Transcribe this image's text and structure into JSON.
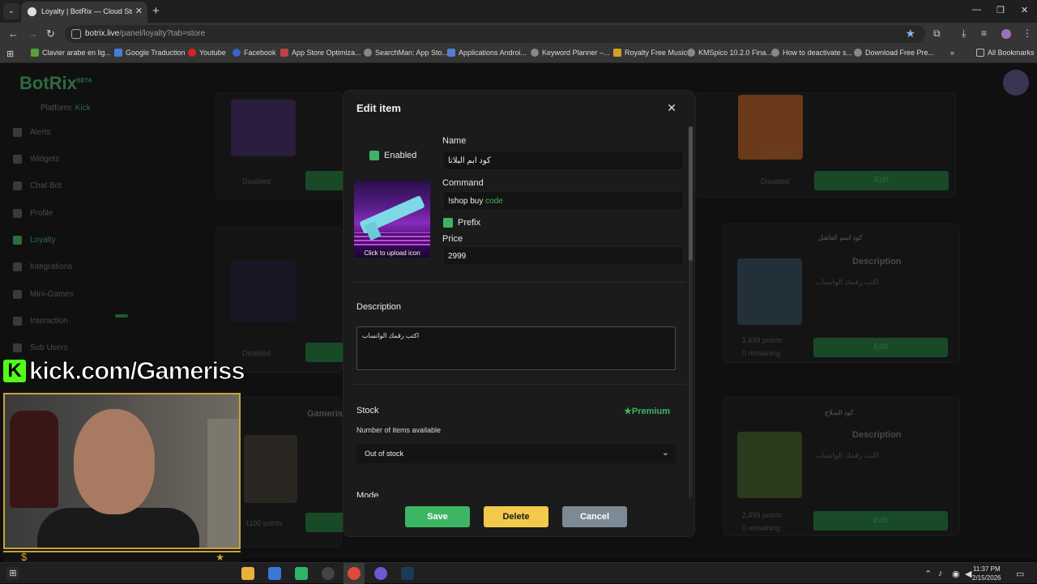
{
  "browser": {
    "tab_title": "Loyalty | BotRix — Cloud Stream",
    "url_domain": "botrix.live",
    "url_path": "/panel/loyalty?tab=store",
    "bookmarks": [
      "Clavier arabe en lig...",
      "Google Traduction",
      "Youtube",
      "Facebook",
      "App Store Optimiza...",
      "SearchMan: App Sto...",
      "Applications Androi...",
      "Keyword Planner –...",
      "Royalty Free Music",
      "KMSpico 10.2.0 Fina...",
      "How to deactivate s...",
      "Download Free Pre..."
    ],
    "all_bookmarks": "All Bookmarks"
  },
  "app": {
    "logo": "BotRix",
    "logo_badge": "BETA",
    "platform_label": "Platform:",
    "platform_value": "Kick",
    "sidebar": [
      "Alerts",
      "Widgets",
      "Chat Bot",
      "Profile",
      "Loyalty",
      "Integrations",
      "Mini-Games",
      "Interaction",
      "Sub Users"
    ],
    "bg_cards": {
      "disabled": "Disabled",
      "edit": "Edit",
      "description": "Description",
      "c1_title": "كود اسم الفاشل",
      "c1_text": "اكتب رقمك الواتساب",
      "c2_title": "كود السلاح",
      "c2_points": "1,699 points",
      "c2_remaining": "0 remaining",
      "c3_points": "2,499 points",
      "c3_remaining": "0 remaining",
      "streamer_label": "Gameriss",
      "points_1100": "1100 points",
      "orange_label": "orange"
    }
  },
  "overlay": {
    "kick_text": "kick.com/Gameriss"
  },
  "modal": {
    "title": "Edit item",
    "enabled_label": "Enabled",
    "name_label": "Name",
    "name_value": "كود ابم البلاتا",
    "command_label": "Command",
    "command_prefix": "!shop buy ",
    "command_highlight": "code",
    "prefix_label": "Prefix",
    "price_label": "Price",
    "price_value": "2999",
    "upload_caption": "Click to upload icon",
    "description_label": "Description",
    "description_value": "اكتب رقمك الواتساب",
    "stock_label": "Stock",
    "premium_label": "Premium",
    "stock_sub": "Number of items available",
    "stock_value": "Out of stock",
    "mode_label": "Mode",
    "save": "Save",
    "delete": "Delete",
    "cancel": "Cancel"
  },
  "taskbar": {
    "time": "11:37 PM",
    "date": "2/15/2026"
  },
  "colors": {
    "accent_green": "#3cb663",
    "delete_yellow": "#f2c94c",
    "cancel_gray": "#7b8a95"
  }
}
